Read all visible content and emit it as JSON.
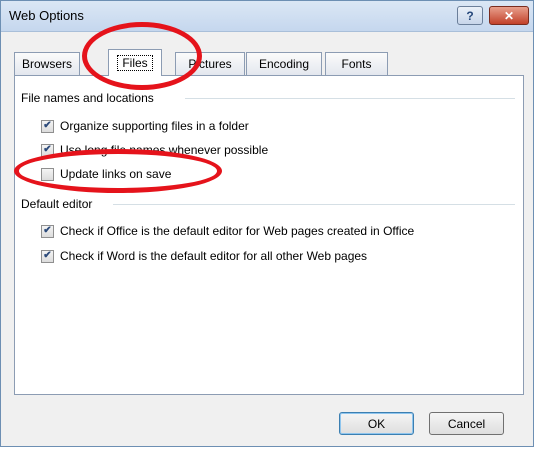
{
  "window": {
    "title": "Web Options",
    "help_glyph": "?",
    "close_glyph": "✕"
  },
  "tabs": [
    {
      "label": "Browsers",
      "active": false
    },
    {
      "label": "Files",
      "active": true
    },
    {
      "label": "Pictures",
      "active": false
    },
    {
      "label": "Encoding",
      "active": false
    },
    {
      "label": "Fonts",
      "active": false
    }
  ],
  "groups": {
    "file_names": {
      "heading": "File names and locations",
      "options": [
        {
          "label": "Organize supporting files in a folder",
          "checked": true
        },
        {
          "label": "Use long file names whenever possible",
          "checked": true
        },
        {
          "label": "Update links on save",
          "checked": false
        }
      ]
    },
    "default_editor": {
      "heading": "Default editor",
      "options": [
        {
          "label": "Check if Office is the default editor for Web pages created in Office",
          "checked": true
        },
        {
          "label": "Check if Word is the default editor for all other Web pages",
          "checked": true
        }
      ]
    }
  },
  "buttons": {
    "ok": "OK",
    "cancel": "Cancel"
  },
  "annotation_color": "#e5131b",
  "check_glyph": "✔"
}
